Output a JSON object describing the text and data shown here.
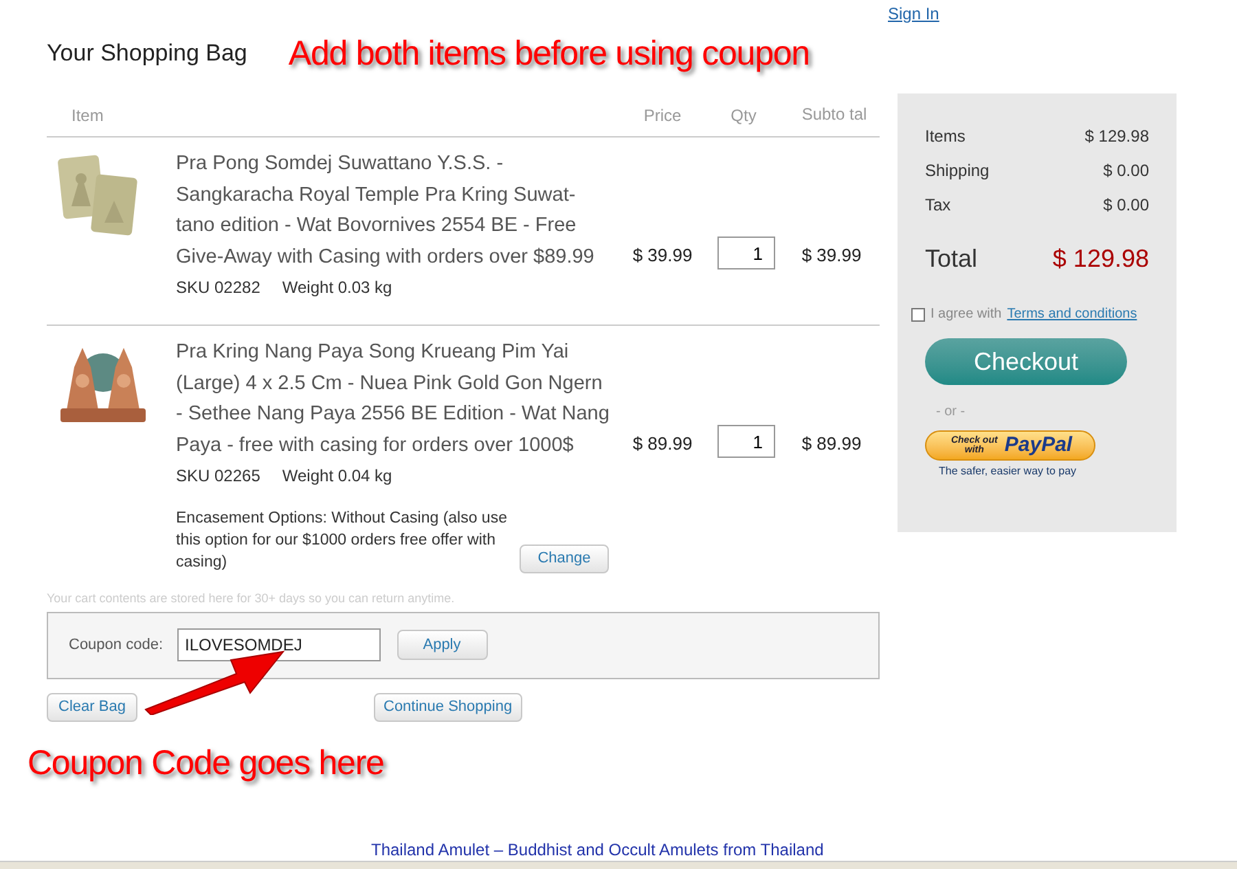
{
  "header": {
    "sign_in": "Sign In",
    "title": "Your Shopping Bag",
    "annotation": "Add both items before using coupon"
  },
  "table": {
    "columns": [
      "Item",
      "Price",
      "Qty",
      "Subto tal"
    ],
    "rows": [
      {
        "name": "Pra Pong Somdej Suwattano Y.S.S. - Sangkaracha Royal Temple Pra Kring Suwat-tano edition - Wat Bovornives 2554 BE - Free Give-Away with Casing with orders over $89.99",
        "sku": "SKU 02282",
        "weight": "Weight 0.03 kg",
        "price": "$ 39.99",
        "qty": "1",
        "subtotal": "$ 39.99"
      },
      {
        "name": "Pra Kring Nang Paya Song Krueang Pim Yai (Large) 4 x 2.5 Cm - Nuea Pink Gold Gon Ngern - Sethee Nang Paya 2556 BE Edition - Wat Nang Paya - free with casing for orders over 1000$",
        "sku": "SKU 02265",
        "weight": "Weight 0.04 kg",
        "price": "$ 89.99",
        "qty": "1",
        "subtotal": "$ 89.99",
        "option": "Encasement Options: Without Casing (also use this option for our $1000 orders free offer with casing)",
        "option_button": "Change"
      }
    ]
  },
  "cart_note": "Your cart contents are stored here for 30+ days so you can return anytime.",
  "coupon": {
    "label": "Coupon code:",
    "value": "ILOVESOMDEJ",
    "button": "Apply"
  },
  "buttons": [
    "Clear Bag",
    "Continue Shopping"
  ],
  "annotation_bottom": "Coupon Code goes here",
  "footer": "Thailand Amulet – Buddhist and Occult Amulets from Thailand",
  "summary": {
    "lines": [
      {
        "label": "Items",
        "value": "$ 129.98"
      },
      {
        "label": "Shipping",
        "value": "$ 0.00"
      },
      {
        "label": "Tax",
        "value": "$ 0.00"
      }
    ],
    "total_label": "Total",
    "total_value": "$ 129.98",
    "agree": {
      "checked": false,
      "text": "I agree with",
      "link": "Terms and conditions"
    },
    "checkout": "Checkout",
    "or": "- or -",
    "paypal": {
      "small": "Check out with",
      "brand": "PayPal",
      "tagline": "The safer, easier way to pay"
    }
  }
}
